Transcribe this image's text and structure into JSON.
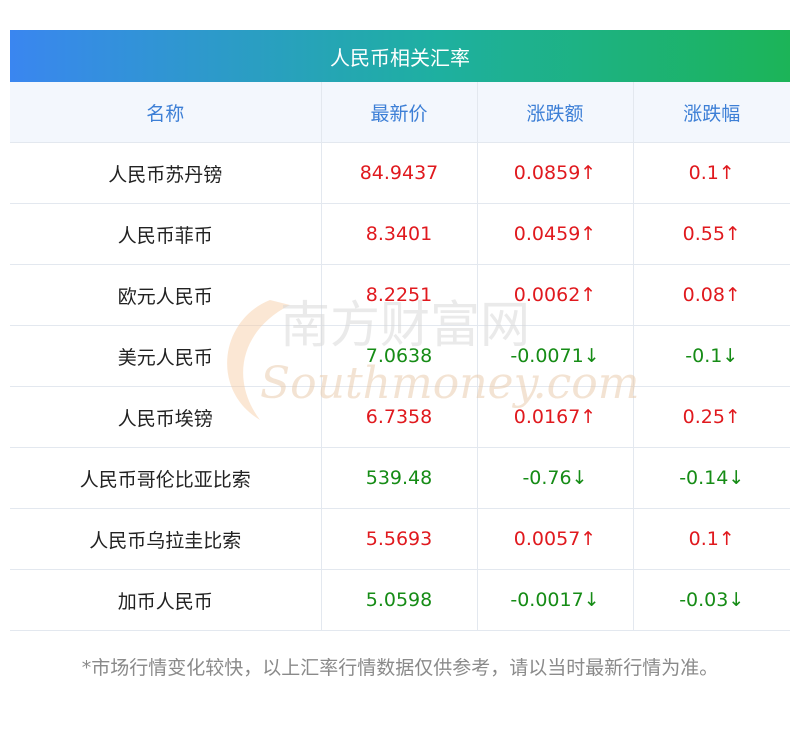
{
  "header": {
    "title": "人民币相关汇率"
  },
  "table": {
    "columns": [
      "名称",
      "最新价",
      "涨跌额",
      "涨跌幅"
    ],
    "rows": [
      {
        "name": "人民币苏丹镑",
        "price": "84.9437",
        "change": "0.0859↑",
        "pct": "0.1↑",
        "dir": "up"
      },
      {
        "name": "人民币菲币",
        "price": "8.3401",
        "change": "0.0459↑",
        "pct": "0.55↑",
        "dir": "up"
      },
      {
        "name": "欧元人民币",
        "price": "8.2251",
        "change": "0.0062↑",
        "pct": "0.08↑",
        "dir": "up"
      },
      {
        "name": "美元人民币",
        "price": "7.0638",
        "change": "-0.0071↓",
        "pct": "-0.1↓",
        "dir": "down"
      },
      {
        "name": "人民币埃镑",
        "price": "6.7358",
        "change": "0.0167↑",
        "pct": "0.25↑",
        "dir": "up"
      },
      {
        "name": "人民币哥伦比亚比索",
        "price": "539.48",
        "change": "-0.76↓",
        "pct": "-0.14↓",
        "dir": "down"
      },
      {
        "name": "人民币乌拉圭比索",
        "price": "5.5693",
        "change": "0.0057↑",
        "pct": "0.1↑",
        "dir": "up"
      },
      {
        "name": "加币人民币",
        "price": "5.0598",
        "change": "-0.0017↓",
        "pct": "-0.03↓",
        "dir": "down"
      }
    ]
  },
  "watermark": {
    "cn": "南方财富网",
    "en": "Southmoney.com"
  },
  "footnote": "*市场行情变化较快，以上汇率行情数据仅供参考，请以当时最新行情为准。",
  "colors": {
    "up": "#e0191e",
    "down": "#168c16",
    "header_text": "#3d7fd6"
  }
}
